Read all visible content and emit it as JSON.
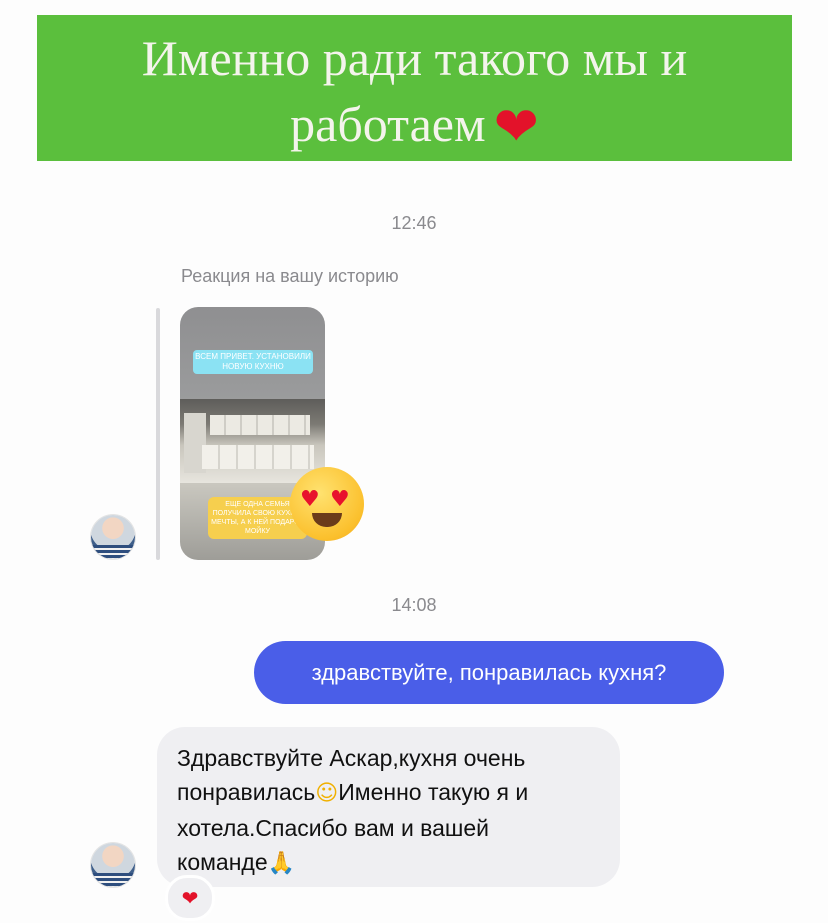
{
  "banner": {
    "line1": "Именно ради такого мы и",
    "line2": "работаем",
    "heart": "❤"
  },
  "thread": {
    "time1": "12:46",
    "story_reaction_label": "Реакция на вашу историю",
    "story": {
      "sticker_top": "ВСЕМ ПРИВЕТ. УСТАНОВИЛИ НОВУЮ КУХНЮ",
      "sticker_bottom": "ЕЩЕ ОДНА СЕМЬЯ ПОЛУЧИЛА СВОЮ КУХНЮ МЕЧТЫ, А К НЕЙ ПОДАРОК МОЙКУ"
    },
    "story_emoji": "heart-eyes-emoji",
    "time2": "14:08",
    "outgoing_message": "здравствуйте, понравилась кухня?",
    "incoming_message": {
      "line1": "Здравствуйте Аскар,кухня очень",
      "line2_a": "понравилась",
      "line2_emoji": "☺",
      "line2_b": "Именно такую я и",
      "line3": "хотела.Спасибо вам и вашей",
      "line4_a": "команде",
      "line4_emoji": "🙏"
    },
    "message_reaction": "❤"
  },
  "colors": {
    "banner_green": "#5bbf3d",
    "outgoing_bubble": "#4a5ee8",
    "incoming_bubble": "#efeff2",
    "heart_red": "#e3122a"
  }
}
